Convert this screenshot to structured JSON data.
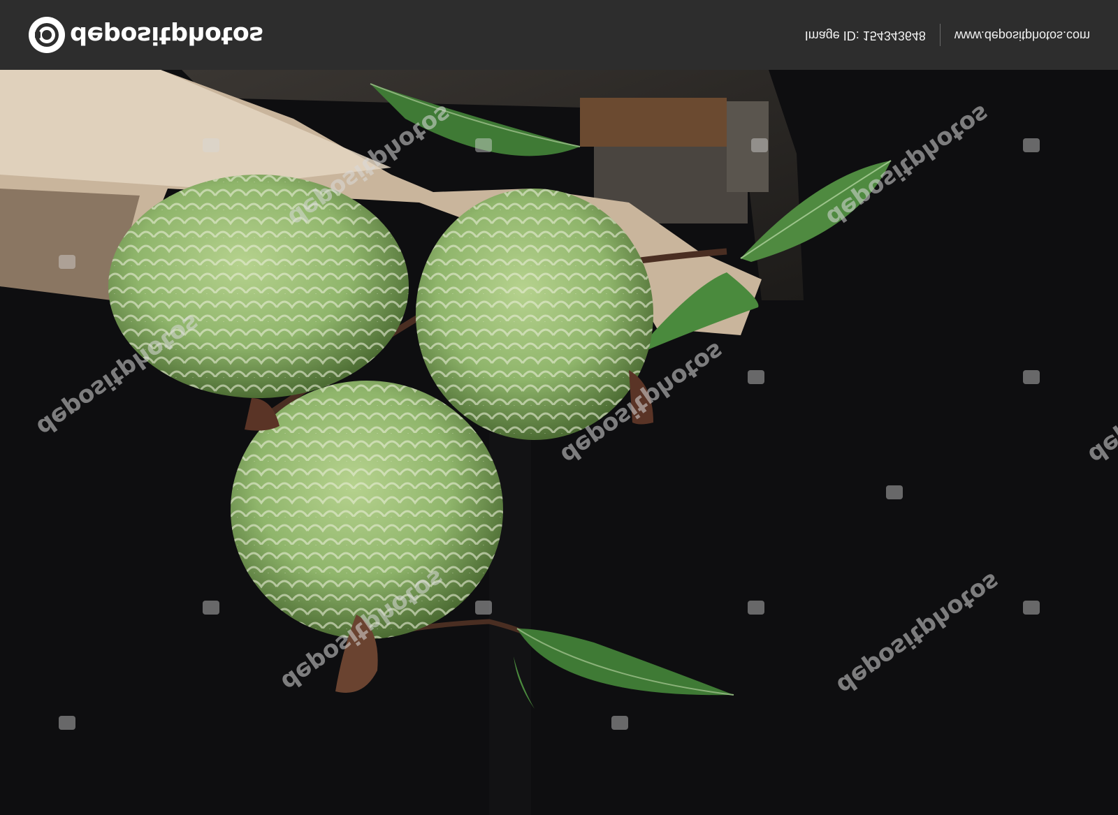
{
  "header": {
    "brand": "depositphotos",
    "image_id_label": "Image ID: 154343648",
    "site_url": "www.depositphotos.com"
  },
  "photo": {
    "watermark_text": "depositphotos"
  },
  "colors": {
    "header_bg": "#2d2d2d",
    "photo_bg": "#0e0e10",
    "fruit_green": "#8fb56b",
    "leaf_green": "#3f7a35",
    "paper": "#c9b59c"
  }
}
